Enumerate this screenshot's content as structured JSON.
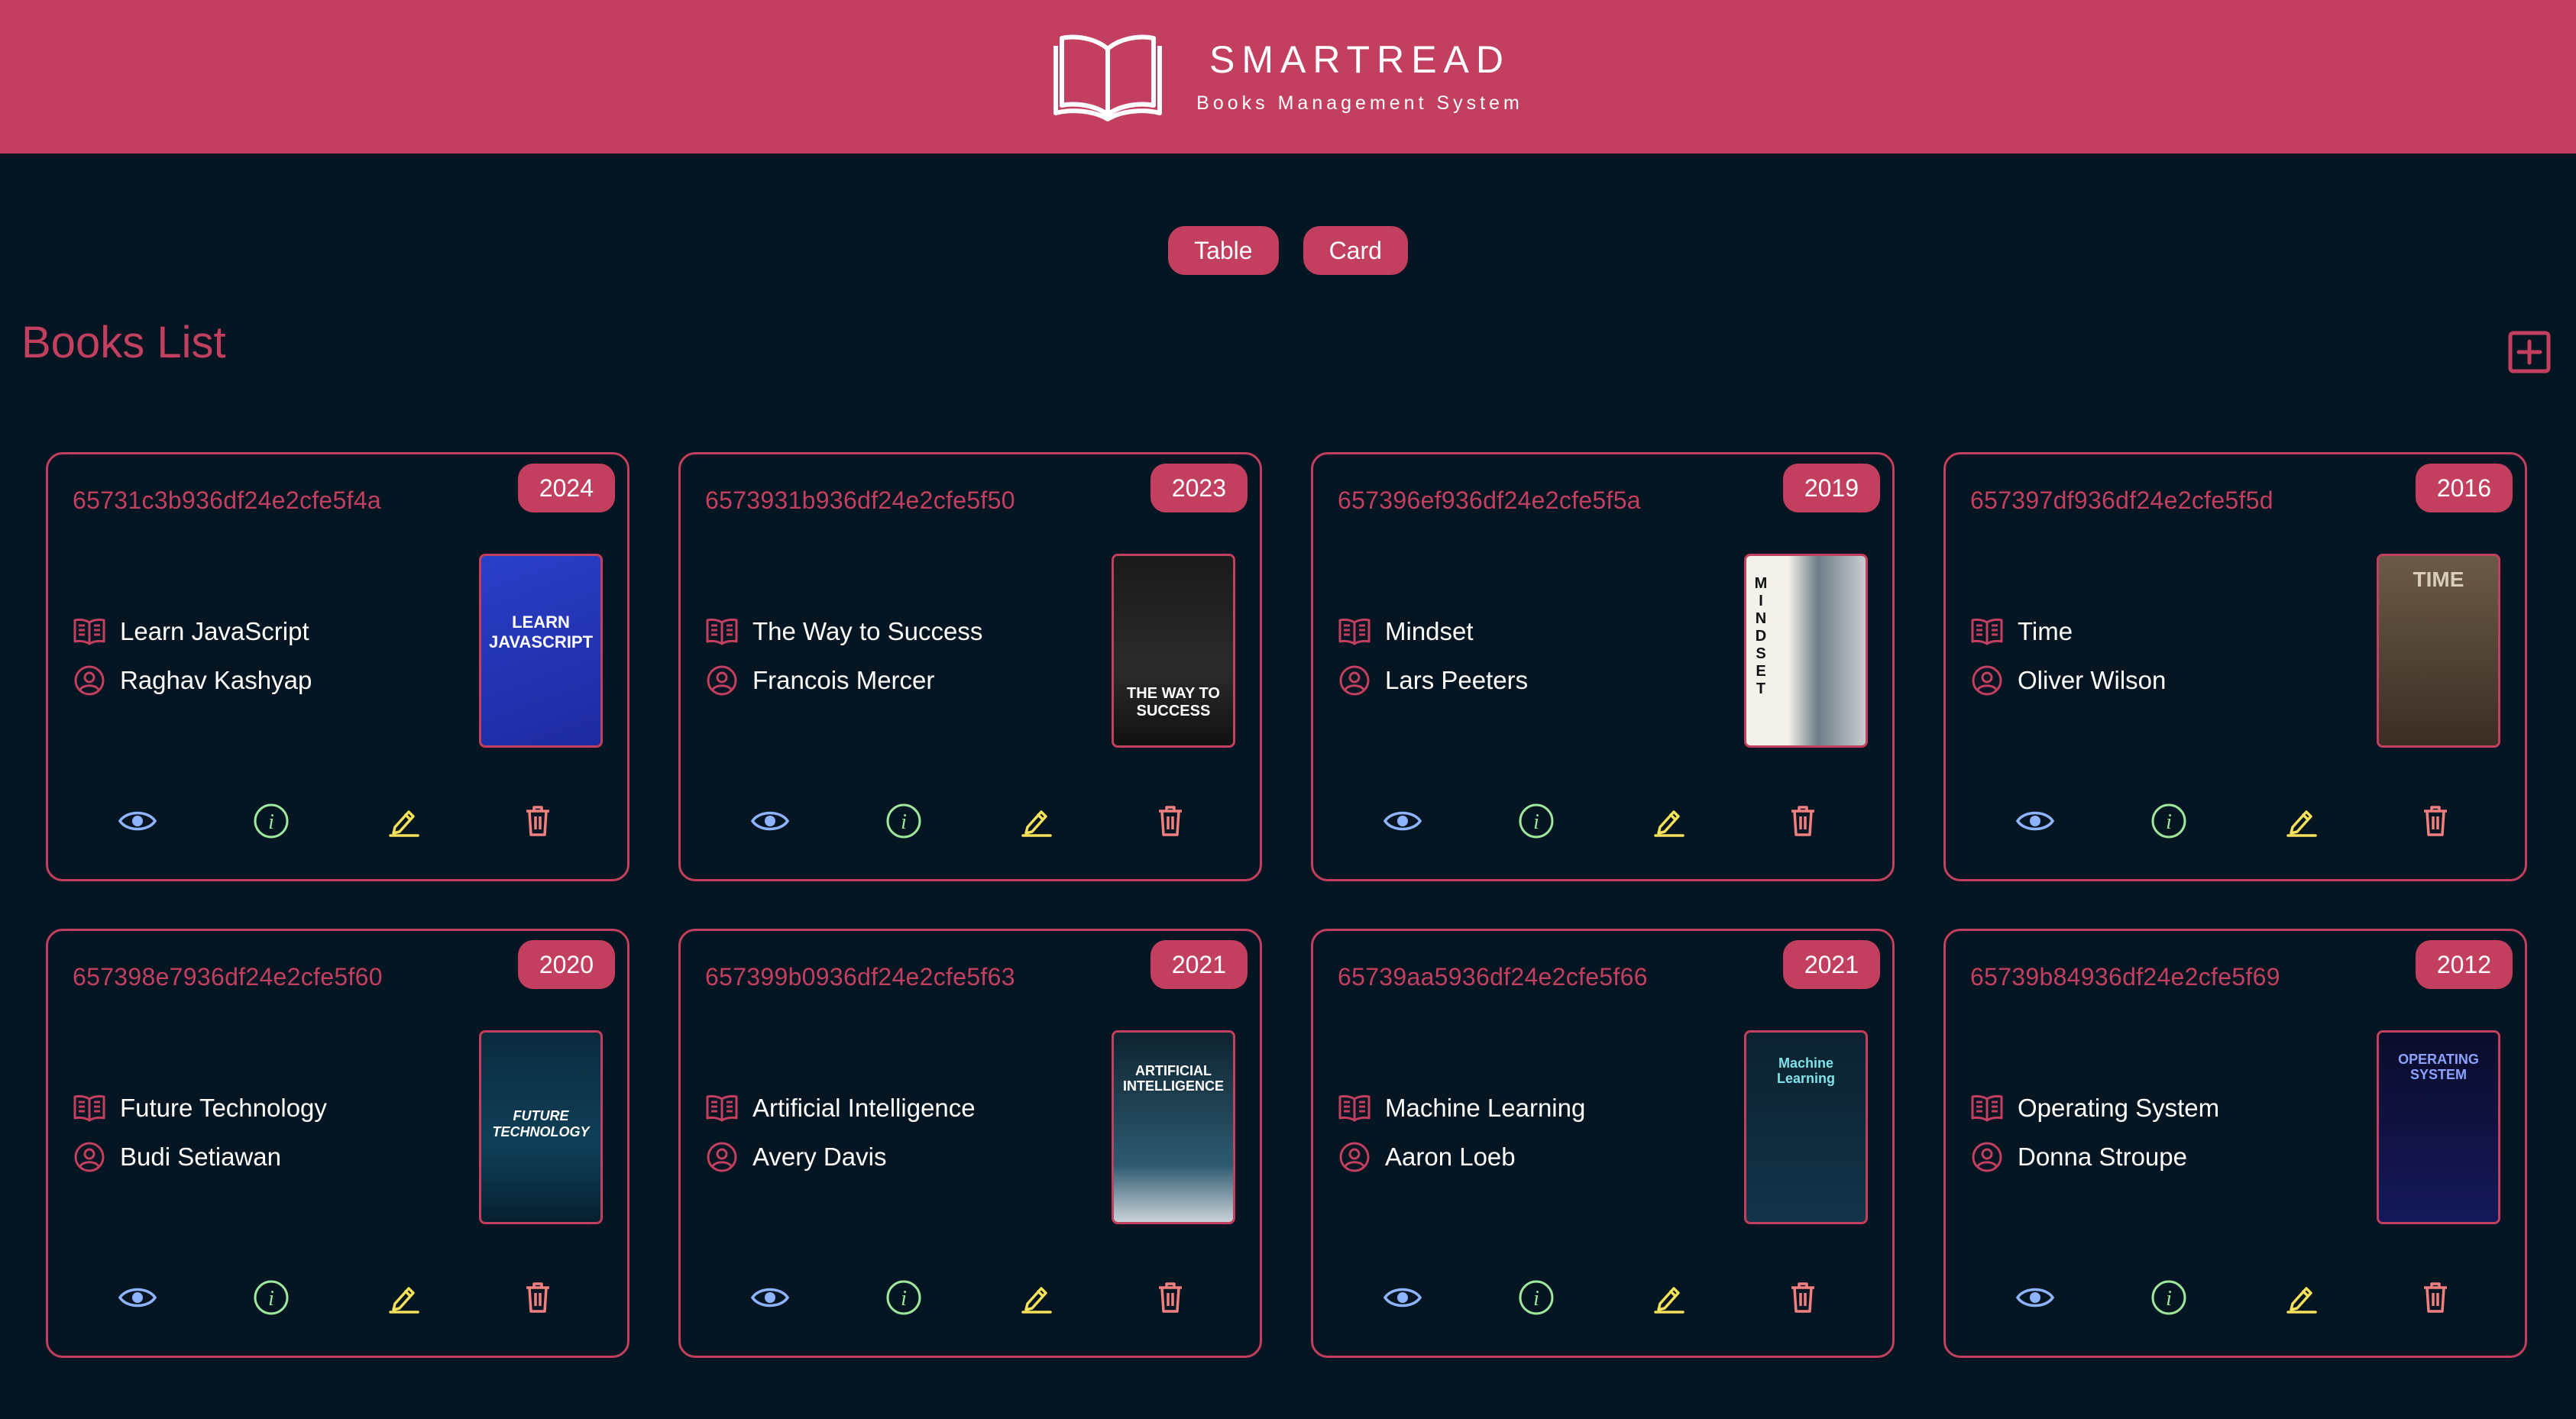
{
  "header": {
    "brand_title": "SMARTREAD",
    "brand_subtitle": "Books Management System",
    "background": "#c33f60"
  },
  "view_toggle": {
    "table_label": "Table",
    "card_label": "Card"
  },
  "page": {
    "title": "Books List",
    "add_icon": "plus-square-icon"
  },
  "colors": {
    "accent": "#c33f60",
    "background": "#051622",
    "view_icon": "#8fb4ff",
    "info_icon": "#9ee89e",
    "edit_icon": "#f5e15a",
    "delete_icon": "#f08080"
  },
  "books": [
    {
      "id": "65731c3b936df24e2cfe5f4a",
      "year": "2024",
      "title": "Learn JavaScript",
      "author": "Raghav Kashyap",
      "cover_text": "LEARN JAVASCRIPT"
    },
    {
      "id": "6573931b936df24e2cfe5f50",
      "year": "2023",
      "title": "The Way to Success",
      "author": "Francois Mercer",
      "cover_text": "THE WAY TO SUCCESS"
    },
    {
      "id": "657396ef936df24e2cfe5f5a",
      "year": "2019",
      "title": "Mindset",
      "author": "Lars Peeters",
      "cover_text": "MINDSET"
    },
    {
      "id": "657397df936df24e2cfe5f5d",
      "year": "2016",
      "title": "Time",
      "author": "Oliver Wilson",
      "cover_text": "TIME"
    },
    {
      "id": "657398e7936df24e2cfe5f60",
      "year": "2020",
      "title": "Future Technology",
      "author": "Budi Setiawan",
      "cover_text": "FUTURE TECHNOLOGY"
    },
    {
      "id": "657399b0936df24e2cfe5f63",
      "year": "2021",
      "title": "Artificial Intelligence",
      "author": "Avery Davis",
      "cover_text": "ARTIFICIAL INTELLIGENCE"
    },
    {
      "id": "65739aa5936df24e2cfe5f66",
      "year": "2021",
      "title": "Machine Learning",
      "author": "Aaron Loeb",
      "cover_text": "Machine Learning"
    },
    {
      "id": "65739b84936df24e2cfe5f69",
      "year": "2012",
      "title": "Operating System",
      "author": "Donna Stroupe",
      "cover_text": "OPERATING SYSTEM"
    }
  ],
  "actions": {
    "view_icon": "eye-icon",
    "info_icon": "info-circle-icon",
    "edit_icon": "pencil-icon",
    "delete_icon": "trash-icon"
  }
}
